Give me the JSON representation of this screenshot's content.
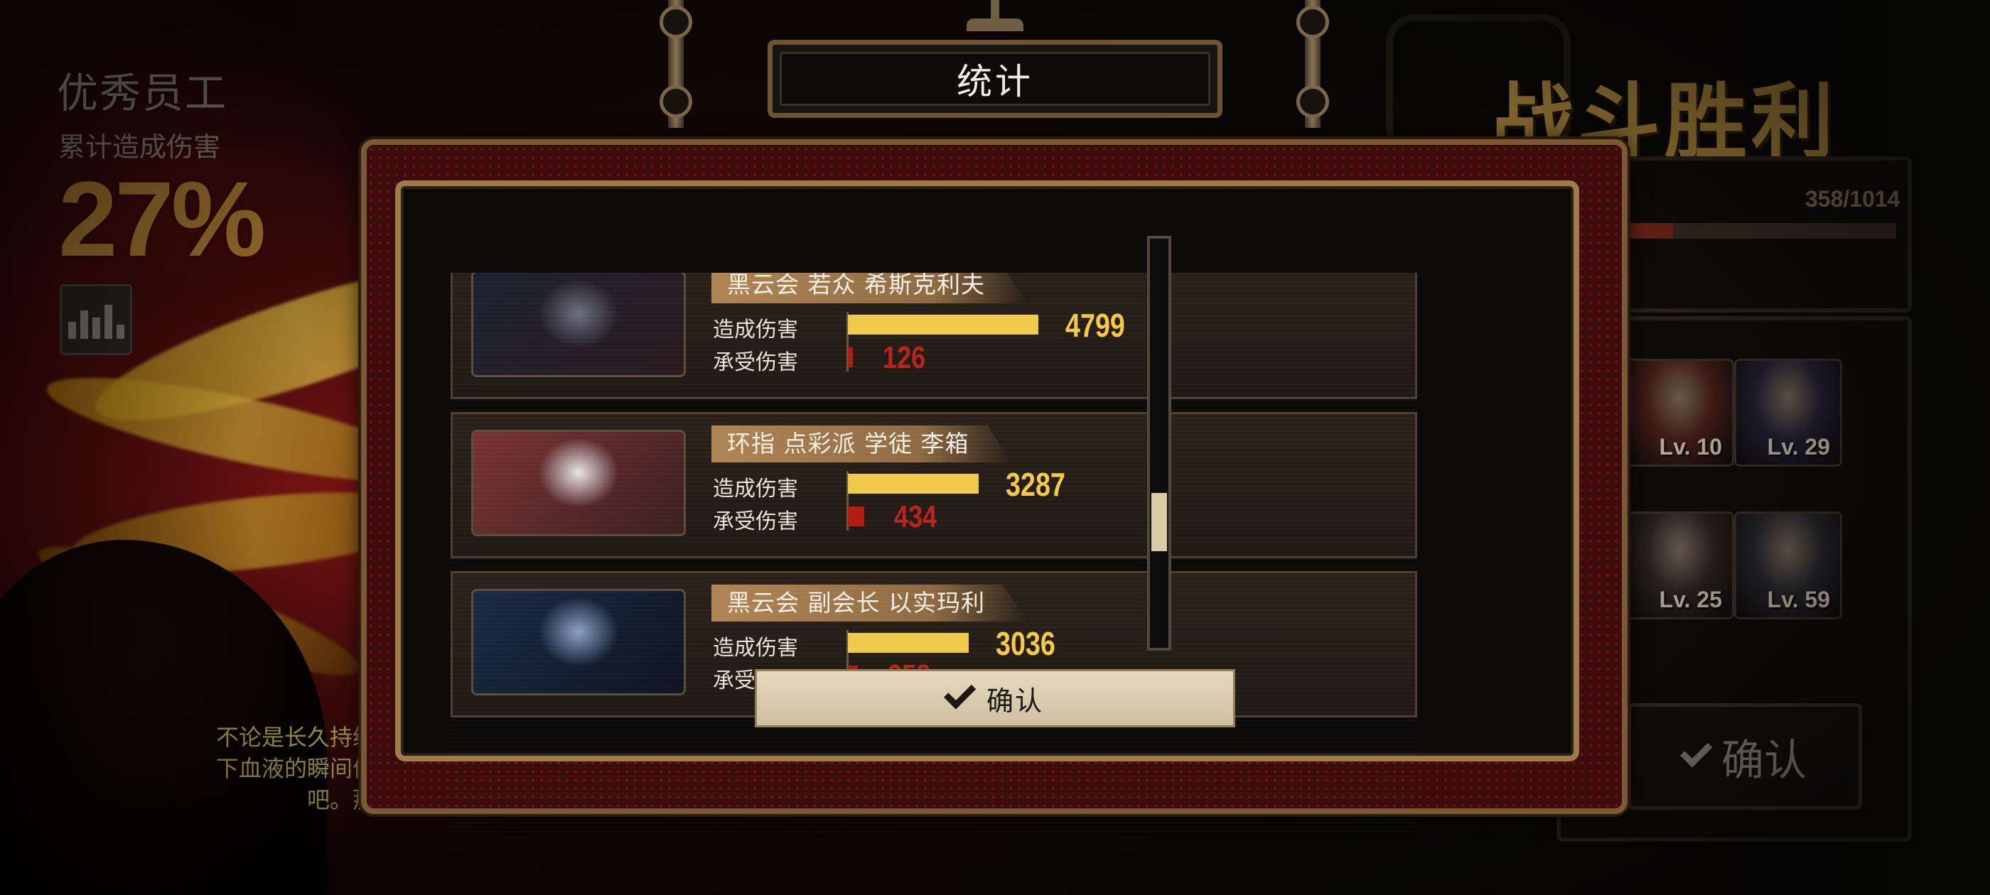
{
  "left": {
    "title": "优秀员工",
    "subtitle": "累计造成伤害",
    "percent": "27%",
    "quote": "不论是长久持续\n下血液的瞬间便\n吧。那"
  },
  "right": {
    "victory": "战斗胜利",
    "exp_text": "358/1014",
    "exp_progress": 0.17,
    "portraits": [
      {
        "level": "Lv. 10",
        "color": "#4a1f1a"
      },
      {
        "level": "Lv. 29",
        "color": "#252235"
      },
      {
        "level": "Lv. 25",
        "color": "#2d2622"
      },
      {
        "level": "Lv. 59",
        "color": "#2a2a30"
      }
    ],
    "confirm": "确认"
  },
  "dialog": {
    "title": "统计",
    "damage_label": "造成伤害",
    "taken_label": "承受伤害",
    "confirm": "确认",
    "scroll_position": 0.74,
    "entries": [
      {
        "name": "黑云会 若众 希斯克利夫",
        "damage": 4799,
        "taken": 126,
        "art": [
          "#1d2230",
          "#6b7080",
          "#2a1a1e"
        ]
      },
      {
        "name": "环指 点彩派 学徒 李箱",
        "damage": 3287,
        "taken": 434,
        "art": [
          "#7a3236",
          "#e8e4e6",
          "#3a2020"
        ]
      },
      {
        "name": "黑云会 副会长 以实玛利",
        "damage": 3036,
        "taken": 258,
        "art": [
          "#1b2a44",
          "#8aa0c4",
          "#0e1422"
        ]
      }
    ],
    "max_damage": 4799
  }
}
